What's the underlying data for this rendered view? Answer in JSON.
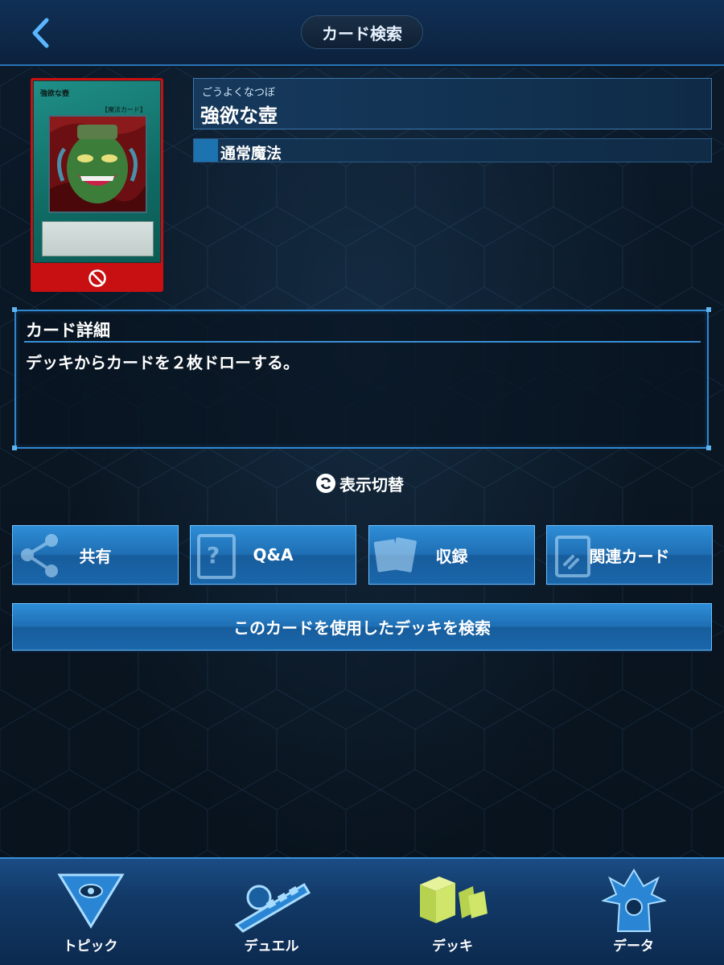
{
  "header": {
    "title": "カード検索",
    "back_icon": "chevron-left-icon"
  },
  "card": {
    "name_ruby": "ごうよくなつぼ",
    "name": "強欲な壺",
    "type": "通常魔法",
    "art_title": "強欲な壺",
    "art_type_tag": "【魔法カード】",
    "status_icon": "forbidden-icon",
    "status_color": "#c80f12",
    "type_color": "#1d73b0"
  },
  "detail": {
    "title": "カード詳細",
    "text": "デッキからカードを２枚ドローする。"
  },
  "toggle": {
    "label": "表示切替",
    "icon": "swap-icon"
  },
  "actions": [
    {
      "label": "共有",
      "icon": "share-icon"
    },
    {
      "label": "Q&A",
      "icon": "question-card-icon"
    },
    {
      "label": "収録",
      "icon": "cards-stack-icon"
    },
    {
      "label": "関連カード",
      "icon": "linked-card-icon"
    }
  ],
  "search_deck_button": "このカードを使用したデッキを検索",
  "bottom_nav": [
    {
      "label": "トピック",
      "icon": "millennium-puzzle-icon"
    },
    {
      "label": "デュエル",
      "icon": "duel-disk-icon"
    },
    {
      "label": "デッキ",
      "icon": "deck-icon",
      "active": true
    },
    {
      "label": "データ",
      "icon": "character-icon"
    }
  ],
  "colors": {
    "accent": "#2f87d0",
    "button": "#1f6fb4",
    "active_nav": "#c8e86a"
  }
}
